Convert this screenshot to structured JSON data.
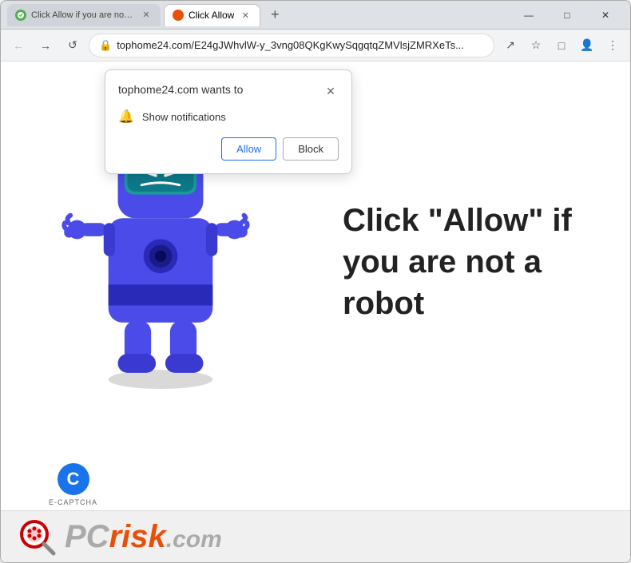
{
  "browser": {
    "tabs": [
      {
        "id": "tab1",
        "label": "Click Allow if you are not a robot",
        "active": false,
        "favicon_color": "#4caf50"
      },
      {
        "id": "tab2",
        "label": "Click Allow",
        "active": true,
        "favicon_color": "#e8500a"
      }
    ],
    "new_tab_label": "+",
    "address": "tophome24.com/E24gJWhvlW-y_3vng08QKgKwySqgqtqZMVlsjZMRXeTs...",
    "window_controls": {
      "minimize": "—",
      "maximize": "□",
      "close": "✕"
    }
  },
  "nav": {
    "back": "←",
    "forward": "→",
    "refresh": "↺"
  },
  "popup": {
    "title": "tophome24.com wants to",
    "permission_label": "Show notifications",
    "close_icon": "✕",
    "allow_label": "Allow",
    "block_label": "Block"
  },
  "page": {
    "click_allow_text": "Click \"Allow\" if you are not a robot",
    "ecaptcha_label": "E-CAPTCHA",
    "pcrisk_pc": "PC",
    "pcrisk_risk": "risk",
    "pcrisk_com": ".com"
  }
}
